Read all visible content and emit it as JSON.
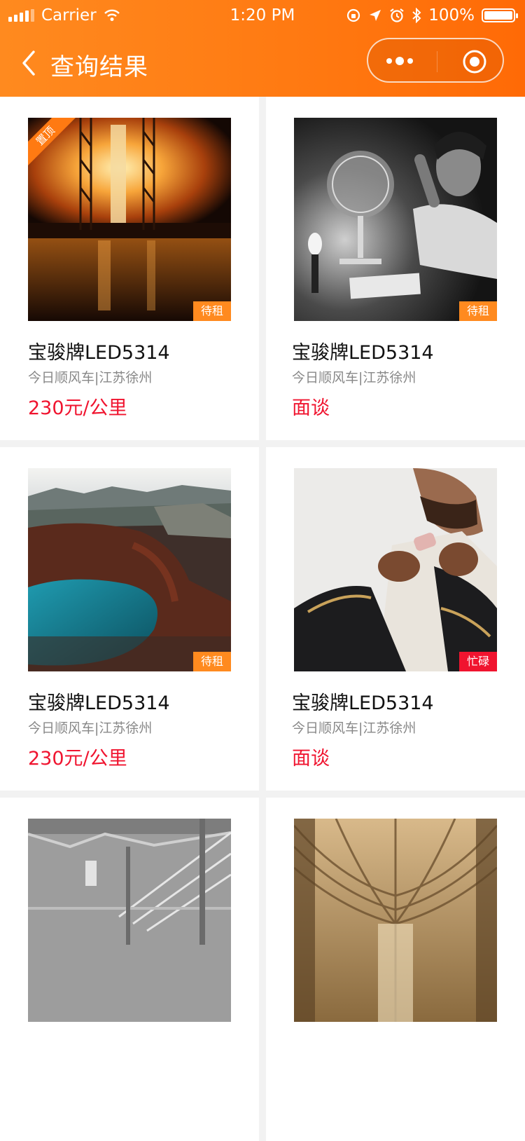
{
  "status_bar": {
    "carrier": "Carrier",
    "time": "1:20 PM",
    "battery": "100%"
  },
  "nav": {
    "title": "查询结果"
  },
  "cards": [
    {
      "name": "宝骏牌LED5314",
      "subtitle": "今日顺风车|江苏徐州",
      "price": "230元/公里",
      "status": "待租",
      "status_color": "#ff8a1f",
      "pinned_label": "置顶",
      "image": "rocket-launch-night"
    },
    {
      "name": "宝骏牌LED5314",
      "subtitle": "今日顺风车|江苏徐州",
      "price": "面谈",
      "status": "待租",
      "status_color": "#ff8a1f",
      "image": "man-with-desk-fan-bw"
    },
    {
      "name": "宝骏牌LED5314",
      "subtitle": "今日顺风车|江苏徐州",
      "price": "230元/公里",
      "status": "待租",
      "status_color": "#ff8a1f",
      "image": "crater-lake-landscape"
    },
    {
      "name": "宝骏牌LED5314",
      "subtitle": "今日顺风车|江苏徐州",
      "price": "面谈",
      "status": "忙碌",
      "status_color": "#f0142f",
      "image": "man-adjusting-suit"
    },
    {
      "image": "staircase-bw"
    },
    {
      "image": "cathedral-ceiling"
    }
  ],
  "colors": {
    "brand": "#ff7a12",
    "price": "#f0142f"
  }
}
